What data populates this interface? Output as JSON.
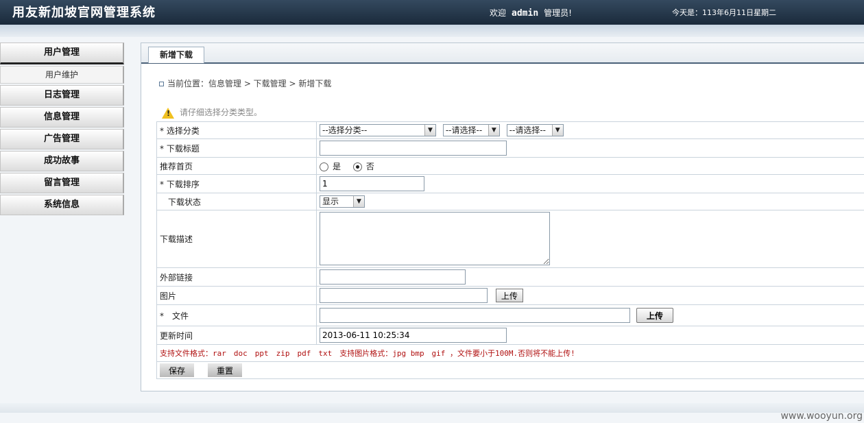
{
  "header": {
    "title": "用友新加坡官网管理系统",
    "welcome_prefix": "欢迎",
    "user": "admin",
    "role": "管理员!",
    "date": "今天是：113年6月11日星期二"
  },
  "sidebar": {
    "items": [
      {
        "label": "用户管理",
        "sub": "用户维护"
      },
      {
        "label": "日志管理"
      },
      {
        "label": "信息管理"
      },
      {
        "label": "广告管理"
      },
      {
        "label": "成功故事"
      },
      {
        "label": "留言管理"
      },
      {
        "label": "系统信息"
      }
    ]
  },
  "main": {
    "tab": "新增下载",
    "breadcrumb": "当前位置：信息管理 > 下载管理 > 新增下载",
    "notice": "请仔细选择分类类型。",
    "form": {
      "category_label": "* 选择分类",
      "category_select1": "--选择分类--",
      "category_select2": "--请选择--",
      "category_select3": "--请选择--",
      "title_label": "* 下载标题",
      "title_value": "",
      "recommend_label": "推荐首页",
      "recommend_yes": "是",
      "recommend_no": "否",
      "order_label": "* 下载排序",
      "order_value": "1",
      "status_label": "下载状态",
      "status_value": "显示",
      "desc_label": "下载描述",
      "link_label": "外部链接",
      "image_label": "图片",
      "image_upload": "上传",
      "file_label": "*　文件",
      "file_upload": "上传",
      "time_label": "更新时间",
      "time_value": "2013-06-11 10:25:34",
      "format_note": "支持文件格式：rar　doc　ppt　zip　pdf　txt　支持图片格式：jpg bmp　gif ，文件要小于100M.否则将不能上传!",
      "save": "保存",
      "reset": "重置"
    }
  },
  "watermark": "www.wooyun.org"
}
